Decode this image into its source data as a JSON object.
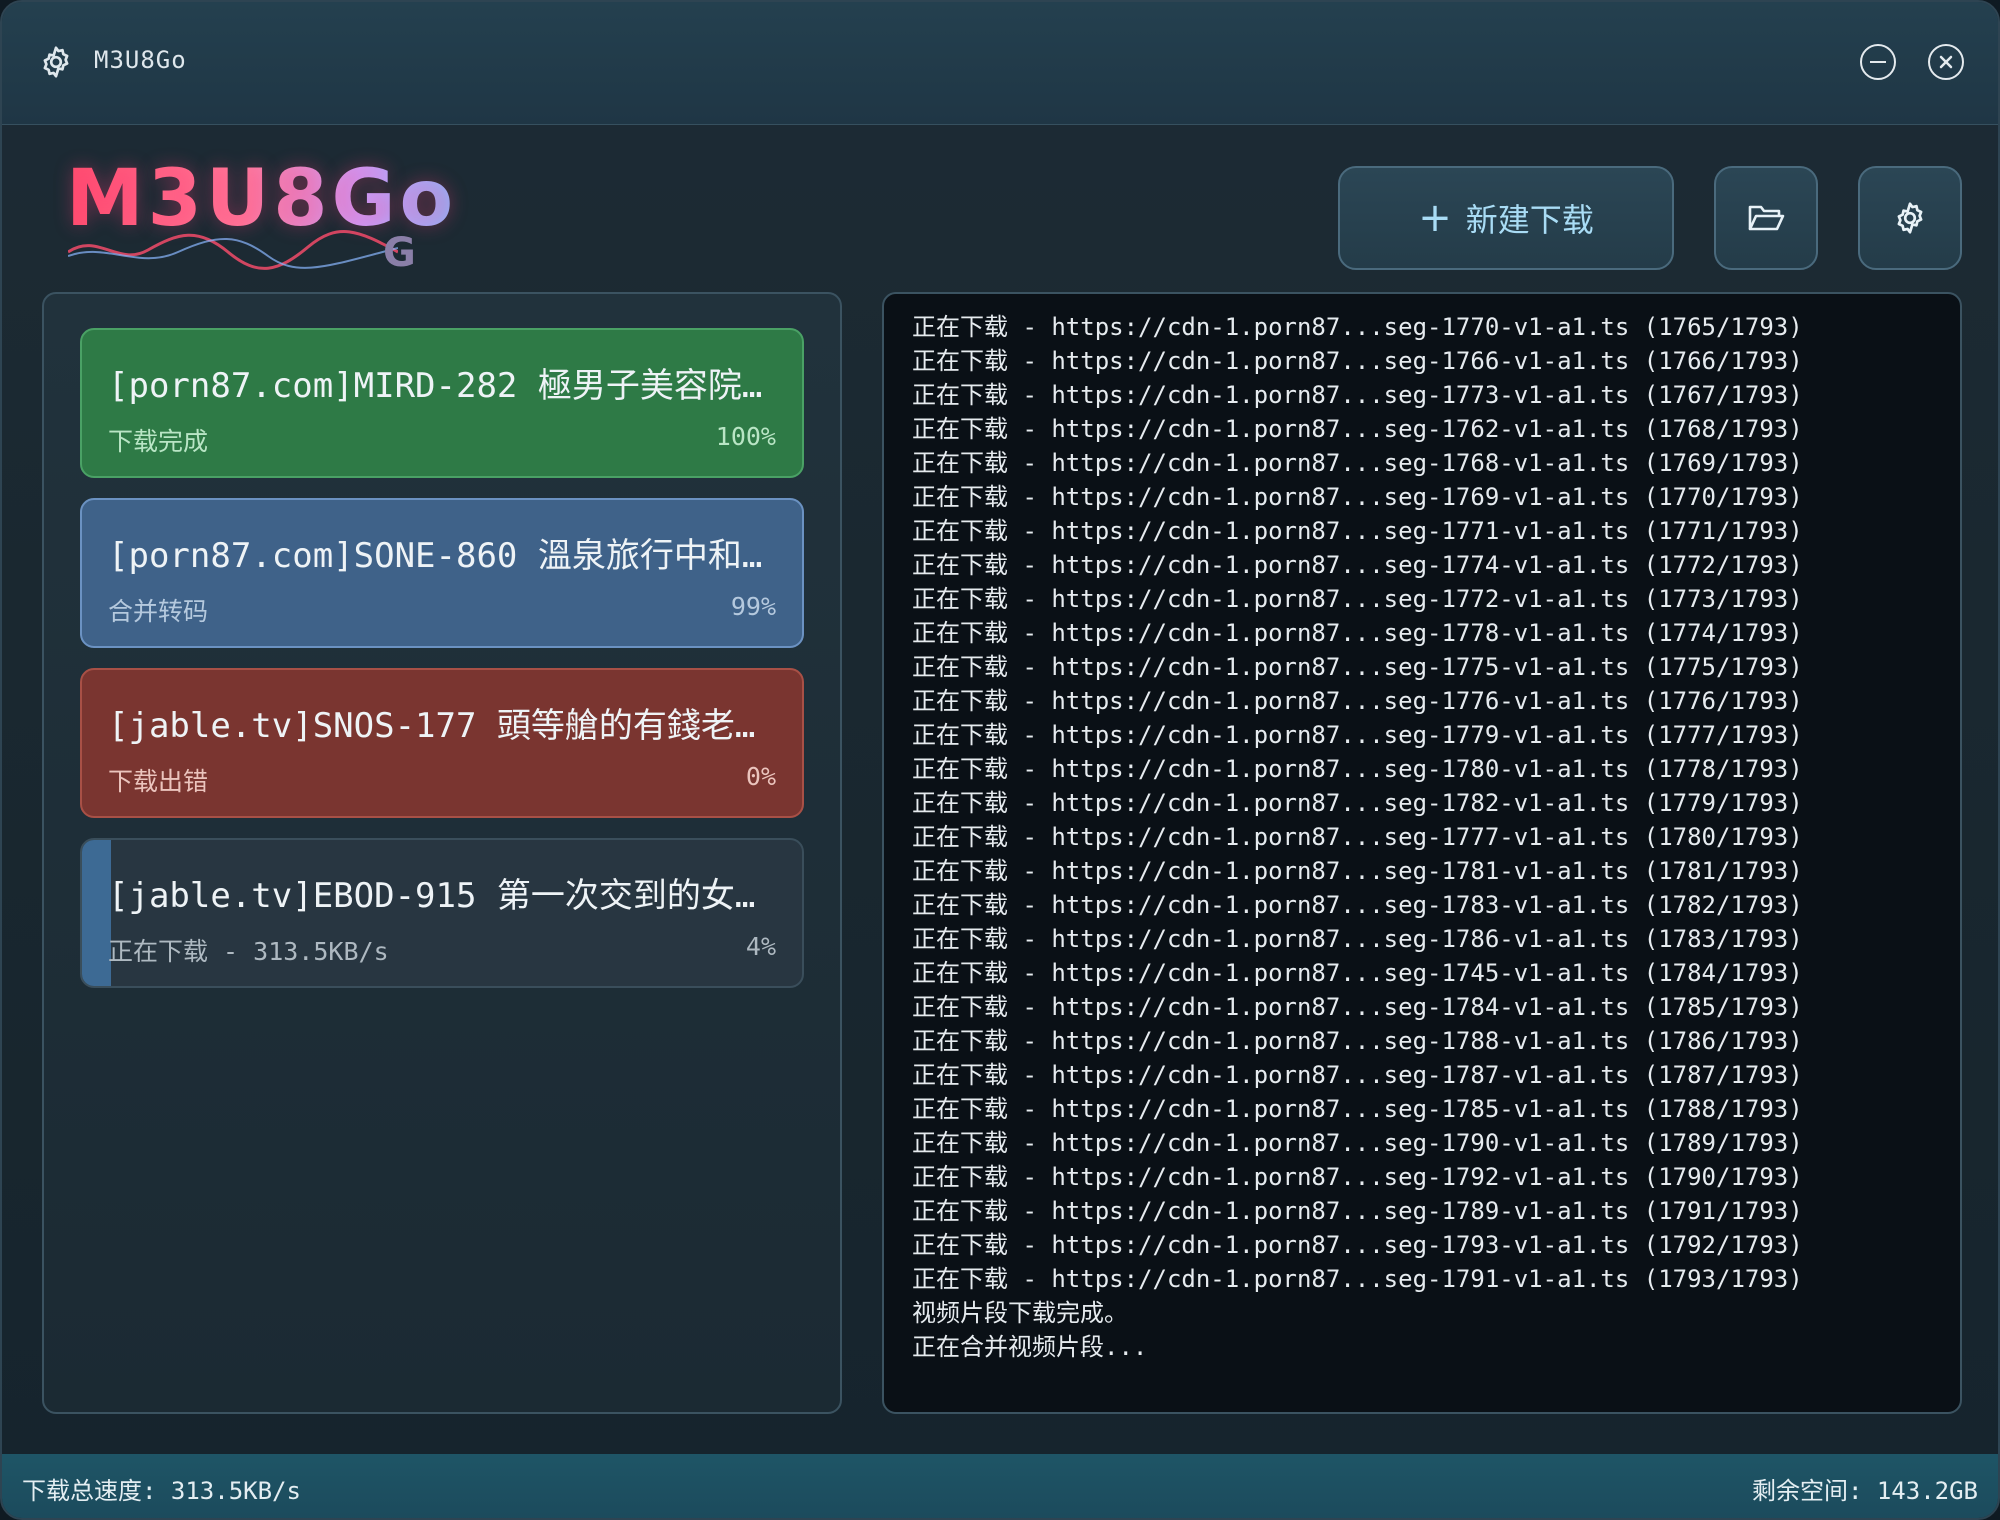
{
  "window": {
    "title": "M3U8Go"
  },
  "logo": {
    "text": "M3U8Go",
    "sub": "G"
  },
  "toolbar": {
    "new_download_label": "新建下载",
    "new_icon": "plus-icon",
    "folder_icon": "folder-open-icon",
    "settings_icon": "gear-icon"
  },
  "tasks": [
    {
      "title": "[porn87.com]MIRD-282 極男子美容院…",
      "status": "下载完成",
      "percent": "100%",
      "progress": 100,
      "color": "#2e7a46"
    },
    {
      "title": "[porn87.com]SONE-860 溫泉旅行中和…",
      "status": "合并转码",
      "percent": "99%",
      "progress": 99,
      "color": "#3f6289"
    },
    {
      "title": "[jable.tv]SNOS-177 頭等艙的有錢老…",
      "status": "下载出错",
      "percent": "0%",
      "progress": 0,
      "color": "#7a3530"
    },
    {
      "title": "[jable.tv]EBOD-915 第一次交到的女…",
      "status": "正在下载 - 313.5KB/s",
      "percent": "4%",
      "progress": 4,
      "color": "#3d6a94"
    }
  ],
  "log": [
    "正在下载 - https://cdn-1.porn87...seg-1770-v1-a1.ts (1765/1793)",
    "正在下载 - https://cdn-1.porn87...seg-1766-v1-a1.ts (1766/1793)",
    "正在下载 - https://cdn-1.porn87...seg-1773-v1-a1.ts (1767/1793)",
    "正在下载 - https://cdn-1.porn87...seg-1762-v1-a1.ts (1768/1793)",
    "正在下载 - https://cdn-1.porn87...seg-1768-v1-a1.ts (1769/1793)",
    "正在下载 - https://cdn-1.porn87...seg-1769-v1-a1.ts (1770/1793)",
    "正在下载 - https://cdn-1.porn87...seg-1771-v1-a1.ts (1771/1793)",
    "正在下载 - https://cdn-1.porn87...seg-1774-v1-a1.ts (1772/1793)",
    "正在下载 - https://cdn-1.porn87...seg-1772-v1-a1.ts (1773/1793)",
    "正在下载 - https://cdn-1.porn87...seg-1778-v1-a1.ts (1774/1793)",
    "正在下载 - https://cdn-1.porn87...seg-1775-v1-a1.ts (1775/1793)",
    "正在下载 - https://cdn-1.porn87...seg-1776-v1-a1.ts (1776/1793)",
    "正在下载 - https://cdn-1.porn87...seg-1779-v1-a1.ts (1777/1793)",
    "正在下载 - https://cdn-1.porn87...seg-1780-v1-a1.ts (1778/1793)",
    "正在下载 - https://cdn-1.porn87...seg-1782-v1-a1.ts (1779/1793)",
    "正在下载 - https://cdn-1.porn87...seg-1777-v1-a1.ts (1780/1793)",
    "正在下载 - https://cdn-1.porn87...seg-1781-v1-a1.ts (1781/1793)",
    "正在下载 - https://cdn-1.porn87...seg-1783-v1-a1.ts (1782/1793)",
    "正在下载 - https://cdn-1.porn87...seg-1786-v1-a1.ts (1783/1793)",
    "正在下载 - https://cdn-1.porn87...seg-1745-v1-a1.ts (1784/1793)",
    "正在下载 - https://cdn-1.porn87...seg-1784-v1-a1.ts (1785/1793)",
    "正在下载 - https://cdn-1.porn87...seg-1788-v1-a1.ts (1786/1793)",
    "正在下载 - https://cdn-1.porn87...seg-1787-v1-a1.ts (1787/1793)",
    "正在下载 - https://cdn-1.porn87...seg-1785-v1-a1.ts (1788/1793)",
    "正在下载 - https://cdn-1.porn87...seg-1790-v1-a1.ts (1789/1793)",
    "正在下载 - https://cdn-1.porn87...seg-1792-v1-a1.ts (1790/1793)",
    "正在下载 - https://cdn-1.porn87...seg-1789-v1-a1.ts (1791/1793)",
    "正在下载 - https://cdn-1.porn87...seg-1793-v1-a1.ts (1792/1793)",
    "正在下载 - https://cdn-1.porn87...seg-1791-v1-a1.ts (1793/1793)",
    "视频片段下载完成。",
    "正在合并视频片段..."
  ],
  "statusbar": {
    "speed": "下载总速度: 313.5KB/s",
    "space": "剩余空间: 143.2GB"
  }
}
